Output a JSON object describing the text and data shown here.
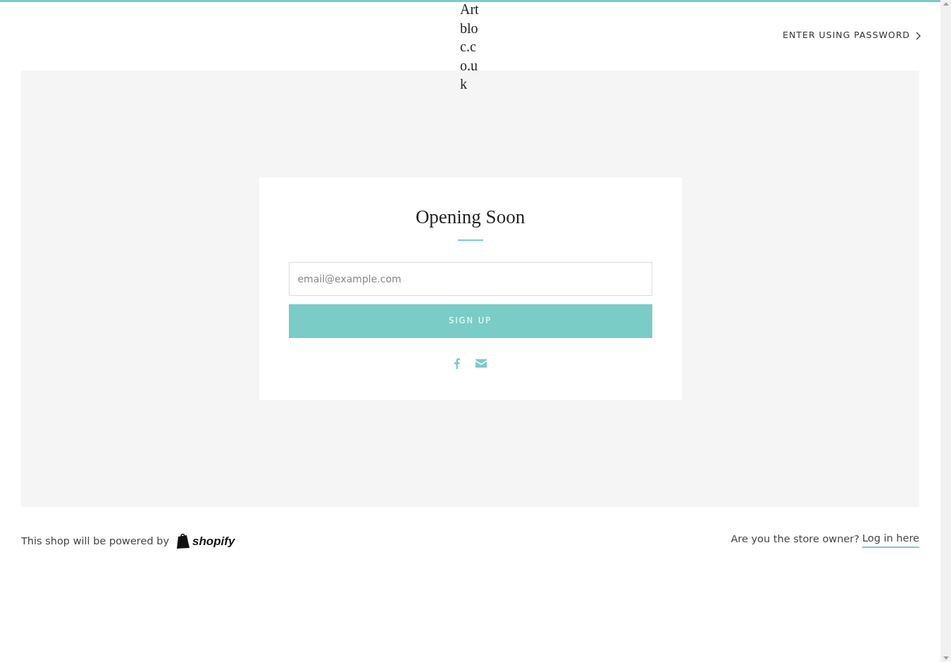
{
  "header": {
    "logo": "Artbloc.co.uk",
    "password_link": "ENTER USING PASSWORD"
  },
  "signup": {
    "title": "Opening Soon",
    "email": {
      "placeholder": "email@example.com"
    },
    "button": "SIGN UP"
  },
  "footer": {
    "powered_by": "This shop will be powered by",
    "brand": "shopify",
    "owner_question": "Are you the store owner?",
    "login_link": "Log in here"
  }
}
